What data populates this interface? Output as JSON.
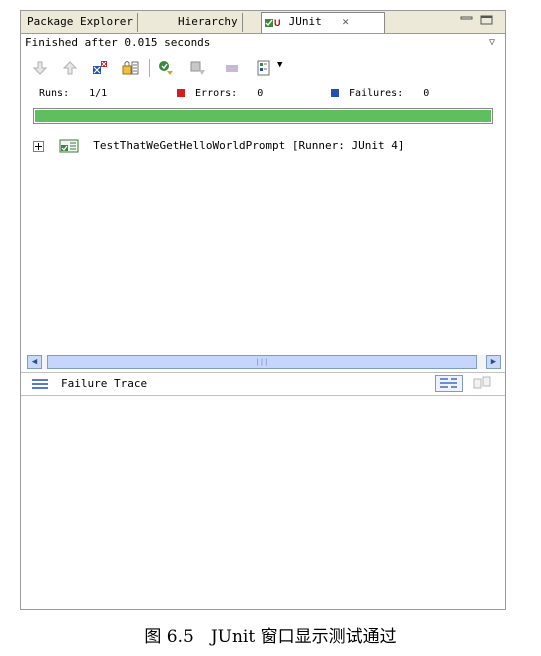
{
  "tabs": [
    {
      "label": "Package Explorer"
    },
    {
      "label": "Hierarchy"
    },
    {
      "label": "JUnit"
    }
  ],
  "status": {
    "text": "Finished after 0.015 seconds"
  },
  "counters": {
    "runs_label": "Runs:",
    "runs_value": "1/1",
    "errors_label": "Errors:",
    "errors_value": "0",
    "failures_label": "Failures:",
    "failures_value": "0"
  },
  "progress": {
    "fraction": 1.0,
    "color": "#5fbf5f"
  },
  "tree": {
    "items": [
      {
        "label": "TestThatWeGetHelloWorldPrompt [Runner: JUnit 4]"
      }
    ]
  },
  "failure_trace": {
    "title": "Failure Trace"
  },
  "caption": "图 6.5　JUnit 窗口显示测试通过"
}
